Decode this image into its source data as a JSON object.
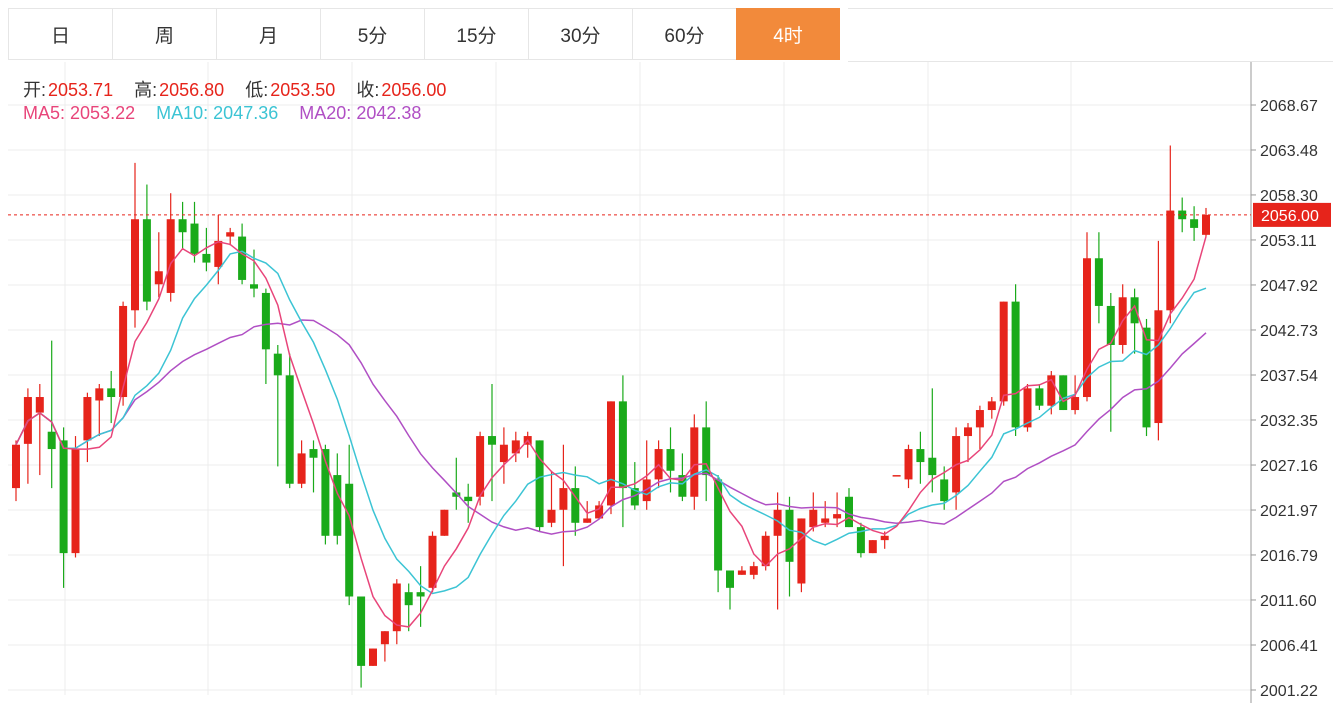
{
  "tabs": [
    {
      "label": "日",
      "active": false
    },
    {
      "label": "周",
      "active": false
    },
    {
      "label": "月",
      "active": false
    },
    {
      "label": "5分",
      "active": false
    },
    {
      "label": "15分",
      "active": false
    },
    {
      "label": "30分",
      "active": false
    },
    {
      "label": "60分",
      "active": false
    },
    {
      "label": "4时",
      "active": true
    }
  ],
  "info": {
    "open_label": "开:",
    "open": "2053.71",
    "high_label": "高:",
    "high": "2056.80",
    "low_label": "低:",
    "low": "2053.50",
    "close_label": "收:",
    "close": "2056.00"
  },
  "ma": {
    "ma5_label": "MA5:",
    "ma5": "2053.22",
    "ma10_label": "MA10:",
    "ma10": "2047.36",
    "ma20_label": "MA20:",
    "ma20": "2042.38"
  },
  "colors": {
    "up": "#e6241b",
    "down": "#1aaa1a",
    "ma5": "#e8457a",
    "ma10": "#3cc4d4",
    "ma20": "#b04fc4",
    "active_tab": "#f28a3b"
  },
  "chart_data": {
    "type": "candlestick",
    "last_price_label": "2056.00",
    "last_price": 2056.0,
    "y_ticks": [
      "2068.67",
      "2063.48",
      "2058.30",
      "2053.11",
      "2047.92",
      "2042.73",
      "2037.54",
      "2032.35",
      "2027.16",
      "2021.97",
      "2016.79",
      "2011.60",
      "2006.41",
      "2001.22"
    ],
    "ylim": [
      2001.22,
      2068.67
    ],
    "candles": [
      [
        2024.5,
        2029.5,
        2023.0,
        2030.0
      ],
      [
        2029.6,
        2035.0,
        2025.0,
        2036.0
      ],
      [
        2033.2,
        2035.0,
        2026.0,
        2036.5
      ],
      [
        2031.0,
        2029.0,
        2024.5,
        2041.5
      ],
      [
        2030.0,
        2017.0,
        2013.0,
        2031.5
      ],
      [
        2017.0,
        2029.0,
        2016.5,
        2030.5
      ],
      [
        2030.0,
        2035.0,
        2027.5,
        2035.5
      ],
      [
        2034.6,
        2036.0,
        2030.5,
        2036.5
      ],
      [
        2036.0,
        2035.0,
        2032.0,
        2038.0
      ],
      [
        2035.0,
        2045.5,
        2034.0,
        2046.0
      ],
      [
        2045.0,
        2055.5,
        2043.0,
        2062.0
      ],
      [
        2055.5,
        2046.0,
        2045.0,
        2059.5
      ],
      [
        2048.0,
        2049.5,
        2046.5,
        2054.0
      ],
      [
        2047.0,
        2055.5,
        2046.0,
        2058.5
      ],
      [
        2055.5,
        2054.0,
        2052.0,
        2057.5
      ],
      [
        2055.0,
        2051.5,
        2050.5,
        2057.5
      ],
      [
        2051.5,
        2050.5,
        2049.5,
        2054.5
      ],
      [
        2050.0,
        2053.0,
        2048.0,
        2056.0
      ],
      [
        2053.5,
        2054.0,
        2052.5,
        2054.5
      ],
      [
        2053.5,
        2048.5,
        2048.0,
        2055.0
      ],
      [
        2048.0,
        2047.5,
        2046.5,
        2052.0
      ],
      [
        2047.0,
        2040.5,
        2036.5,
        2047.5
      ],
      [
        2040.0,
        2037.5,
        2027.0,
        2041.0
      ],
      [
        2037.5,
        2025.0,
        2024.5,
        2040.0
      ],
      [
        2025.0,
        2028.5,
        2024.5,
        2030.0
      ],
      [
        2029.0,
        2028.0,
        2024.0,
        2030.0
      ],
      [
        2029.0,
        2019.0,
        2018.0,
        2029.5
      ],
      [
        2026.0,
        2019.0,
        2018.0,
        2028.5
      ],
      [
        2025.0,
        2012.0,
        2011.0,
        2029.5
      ],
      [
        2012.0,
        2004.0,
        2001.5,
        2012.0
      ],
      [
        2004.0,
        2006.0,
        2004.0,
        2006.0
      ],
      [
        2006.5,
        2008.0,
        2004.5,
        2008.0
      ],
      [
        2008.0,
        2013.5,
        2006.5,
        2014.0
      ],
      [
        2012.5,
        2011.0,
        2008.0,
        2013.5
      ],
      [
        2012.5,
        2012.0,
        2008.5,
        2015.5
      ],
      [
        2013.0,
        2019.0,
        2012.5,
        2019.5
      ],
      [
        2019.0,
        2022.0,
        2019.0,
        2022.0
      ],
      [
        2024.0,
        2023.5,
        2022.0,
        2028.0
      ],
      [
        2023.5,
        2023.0,
        2020.5,
        2025.0
      ],
      [
        2023.5,
        2030.5,
        2022.5,
        2031.0
      ],
      [
        2030.5,
        2029.5,
        2023.0,
        2036.5
      ],
      [
        2027.5,
        2029.5,
        2025.0,
        2031.5
      ],
      [
        2028.5,
        2030.0,
        2027.5,
        2031.0
      ],
      [
        2029.5,
        2030.5,
        2028.0,
        2031.0
      ],
      [
        2030.0,
        2020.0,
        2019.5,
        2030.0
      ],
      [
        2020.5,
        2022.0,
        2020.0,
        2026.5
      ],
      [
        2022.0,
        2024.5,
        2015.5,
        2029.5
      ],
      [
        2024.5,
        2020.5,
        2019.0,
        2027.0
      ],
      [
        2020.5,
        2021.0,
        2020.5,
        2023.0
      ],
      [
        2021.0,
        2022.5,
        2021.0,
        2023.0
      ],
      [
        2022.5,
        2034.5,
        2021.5,
        2034.5
      ],
      [
        2034.5,
        2024.5,
        2020.0,
        2037.5
      ],
      [
        2024.5,
        2022.5,
        2022.0,
        2027.5
      ],
      [
        2023.0,
        2025.5,
        2022.0,
        2030.0
      ],
      [
        2025.5,
        2029.0,
        2024.5,
        2030.0
      ],
      [
        2029.0,
        2026.5,
        2024.0,
        2031.5
      ],
      [
        2026.0,
        2023.5,
        2023.0,
        2028.5
      ],
      [
        2023.5,
        2031.5,
        2022.0,
        2033.0
      ],
      [
        2031.5,
        2026.0,
        2023.0,
        2034.5
      ],
      [
        2025.5,
        2015.0,
        2012.5,
        2026.0
      ],
      [
        2015.0,
        2013.0,
        2010.5,
        2015.0
      ],
      [
        2014.5,
        2015.0,
        2014.5,
        2015.5
      ],
      [
        2014.5,
        2015.5,
        2014.0,
        2016.0
      ],
      [
        2015.5,
        2019.0,
        2015.0,
        2019.5
      ],
      [
        2019.0,
        2022.0,
        2010.5,
        2024.0
      ],
      [
        2022.0,
        2016.0,
        2012.0,
        2023.5
      ],
      [
        2013.5,
        2021.0,
        2012.5,
        2021.0
      ],
      [
        2020.0,
        2022.0,
        2019.5,
        2024.0
      ],
      [
        2020.5,
        2021.0,
        2020.0,
        2023.0
      ],
      [
        2021.0,
        2021.5,
        2020.0,
        2024.0
      ],
      [
        2023.5,
        2020.0,
        2020.0,
        2024.5
      ],
      [
        2020.0,
        2017.0,
        2016.5,
        2020.5
      ],
      [
        2017.0,
        2018.5,
        2017.0,
        2018.5
      ],
      [
        2018.5,
        2019.0,
        2017.5,
        2019.5
      ],
      [
        2026.0,
        2026.0,
        2026.0,
        2026.0
      ],
      [
        2025.5,
        2029.0,
        2024.5,
        2029.5
      ],
      [
        2029.0,
        2027.5,
        2025.0,
        2031.0
      ],
      [
        2028.0,
        2026.0,
        2024.0,
        2036.0
      ],
      [
        2025.5,
        2023.0,
        2022.0,
        2027.0
      ],
      [
        2024.0,
        2030.5,
        2022.0,
        2031.5
      ],
      [
        2030.5,
        2031.5,
        2027.5,
        2032.0
      ],
      [
        2031.5,
        2033.5,
        2029.0,
        2034.0
      ],
      [
        2033.5,
        2034.5,
        2032.5,
        2035.0
      ],
      [
        2034.5,
        2046.0,
        2034.0,
        2046.0
      ],
      [
        2046.0,
        2031.5,
        2030.5,
        2048.0
      ],
      [
        2031.5,
        2036.0,
        2031.0,
        2036.5
      ],
      [
        2036.0,
        2034.0,
        2033.5,
        2036.5
      ],
      [
        2034.0,
        2037.5,
        2033.0,
        2038.0
      ],
      [
        2037.5,
        2033.5,
        2033.5,
        2037.5
      ],
      [
        2033.5,
        2035.0,
        2033.0,
        2037.5
      ],
      [
        2035.0,
        2051.0,
        2034.5,
        2054.0
      ],
      [
        2051.0,
        2045.5,
        2043.5,
        2054.0
      ],
      [
        2045.5,
        2041.0,
        2031.0,
        2047.0
      ],
      [
        2041.0,
        2046.5,
        2040.0,
        2048.0
      ],
      [
        2046.5,
        2043.5,
        2040.0,
        2047.5
      ],
      [
        2043.0,
        2031.5,
        2030.5,
        2044.0
      ],
      [
        2032.0,
        2045.0,
        2030.0,
        2053.0
      ],
      [
        2045.0,
        2056.5,
        2043.5,
        2064.0
      ],
      [
        2056.5,
        2055.5,
        2054.0,
        2058.0
      ],
      [
        2055.5,
        2054.5,
        2053.0,
        2057.0
      ],
      [
        2053.7,
        2056.0,
        2053.5,
        2056.8
      ]
    ]
  }
}
